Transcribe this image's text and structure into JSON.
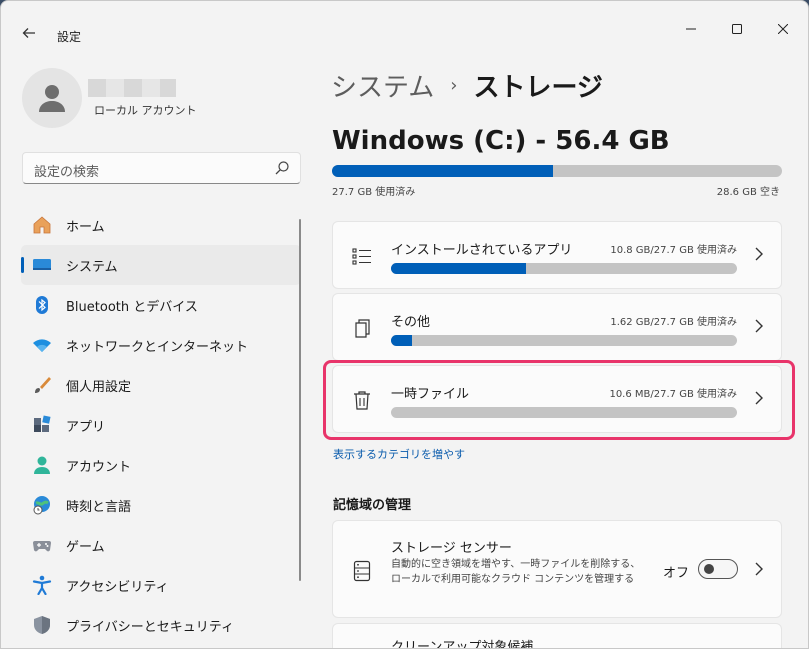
{
  "window": {
    "app_title": "設定",
    "back_icon": "arrow-left-icon",
    "minimize_icon": "minimize-icon",
    "maximize_icon": "maximize-icon",
    "close_icon": "close-icon"
  },
  "profile": {
    "account_type": "ローカル アカウント"
  },
  "search": {
    "placeholder": "設定の検索",
    "icon": "search-icon"
  },
  "sidebar": {
    "items": [
      {
        "label": "ホーム",
        "icon": "home-icon",
        "active": false
      },
      {
        "label": "システム",
        "icon": "system-icon",
        "active": true
      },
      {
        "label": "Bluetooth とデバイス",
        "icon": "bluetooth-icon",
        "active": false
      },
      {
        "label": "ネットワークとインターネット",
        "icon": "wifi-icon",
        "active": false
      },
      {
        "label": "個人用設定",
        "icon": "brush-icon",
        "active": false
      },
      {
        "label": "アプリ",
        "icon": "apps-icon",
        "active": false
      },
      {
        "label": "アカウント",
        "icon": "account-icon",
        "active": false
      },
      {
        "label": "時刻と言語",
        "icon": "globe-clock-icon",
        "active": false
      },
      {
        "label": "ゲーム",
        "icon": "gamepad-icon",
        "active": false
      },
      {
        "label": "アクセシビリティ",
        "icon": "accessibility-icon",
        "active": false
      },
      {
        "label": "プライバシーとセキュリティ",
        "icon": "shield-icon",
        "active": false
      }
    ]
  },
  "breadcrumb": {
    "parent": "システム",
    "separator": "›",
    "current": "ストレージ"
  },
  "drive": {
    "title": "Windows (C:) - 56.4 GB",
    "used_label": "27.7 GB 使用済み",
    "free_label": "28.6 GB 空き",
    "used_fraction": 0.49
  },
  "categories": [
    {
      "title": "インストールされているアプリ",
      "value": "10.8 GB/27.7 GB 使用済み",
      "fraction": 0.39,
      "icon": "app-list-icon"
    },
    {
      "title": "その他",
      "value": "1.62 GB/27.7 GB 使用済み",
      "fraction": 0.06,
      "icon": "document-stack-icon"
    },
    {
      "title": "一時ファイル",
      "value": "10.6 MB/27.7 GB 使用済み",
      "fraction": 0.0,
      "icon": "trash-icon"
    }
  ],
  "more_link": "表示するカテゴリを増やす",
  "management": {
    "heading": "記憶域の管理",
    "storage_sense": {
      "title": "ストレージ センサー",
      "description": "自動的に空き領域を増やす、一時ファイルを削除する、ローカルで利用可能なクラウド コンテンツを管理する",
      "toggle_label": "オフ",
      "toggle_on": false,
      "icon": "storage-sense-icon"
    },
    "next_item_title": "クリーンアップ対象候補"
  },
  "colors": {
    "accent": "#005fb8",
    "highlight": "#e8346a",
    "bar_track": "#c4c4c4"
  }
}
